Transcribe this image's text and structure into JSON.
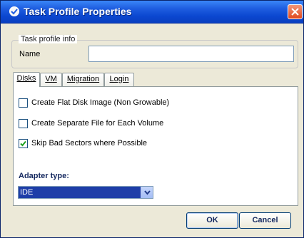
{
  "window": {
    "title": "Task Profile Properties"
  },
  "profile_info": {
    "legend": "Task profile info",
    "name_label": "Name",
    "name_value": ""
  },
  "tabs": [
    {
      "label": "Disks",
      "active": true
    },
    {
      "label": "VM",
      "active": false
    },
    {
      "label": "Migration",
      "active": false
    },
    {
      "label": "Login",
      "active": false
    }
  ],
  "disks": {
    "options": [
      {
        "label": "Create Flat Disk Image (Non Growable)",
        "checked": false
      },
      {
        "label": "Create Separate File for Each Volume",
        "checked": false
      },
      {
        "label": "Skip Bad Sectors where Possible",
        "checked": true
      }
    ],
    "adapter_label": "Adapter type:",
    "adapter_value": "IDE"
  },
  "buttons": {
    "ok": "OK",
    "cancel": "Cancel"
  },
  "icons": {
    "app": "app-icon",
    "close": "close-icon",
    "check": "check-icon",
    "dropdown": "chevron-down-icon"
  },
  "colors": {
    "titlebar": "#0b47d0",
    "selection": "#1e3ea8",
    "close": "#e0481e"
  }
}
